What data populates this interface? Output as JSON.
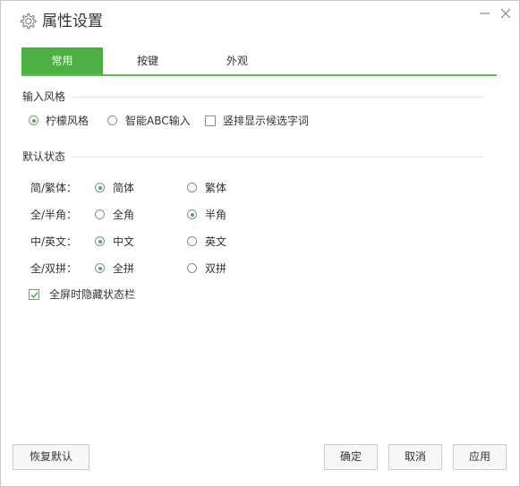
{
  "window": {
    "title": "属性设置"
  },
  "tabs": [
    {
      "label": "常用",
      "active": true
    },
    {
      "label": "按键",
      "active": false
    },
    {
      "label": "外观",
      "active": false
    }
  ],
  "input_style": {
    "title": "输入风格",
    "options": [
      {
        "label": "柠檬风格",
        "checked": true
      },
      {
        "label": "智能ABC输入",
        "checked": false
      }
    ],
    "vertical_candidates_label": "竖排显示候选字词",
    "vertical_candidates_checked": false
  },
  "default_state": {
    "title": "默认状态",
    "rows": [
      {
        "label": "简/繁体：",
        "opt1": "简体",
        "opt2": "繁体",
        "selected": 1
      },
      {
        "label": "全/半角：",
        "opt1": "全角",
        "opt2": "半角",
        "selected": 2
      },
      {
        "label": "中/英文：",
        "opt1": "中文",
        "opt2": "英文",
        "selected": 1
      },
      {
        "label": "全/双拼：",
        "opt1": "全拼",
        "opt2": "双拼",
        "selected": 1
      }
    ],
    "hide_statusbar_label": "全屏时隐藏状态栏",
    "hide_statusbar_checked": true
  },
  "buttons": {
    "restore_default": "恢复默认",
    "ok": "确定",
    "cancel": "取消",
    "apply": "应用"
  },
  "colors": {
    "accent": "#4db044"
  }
}
